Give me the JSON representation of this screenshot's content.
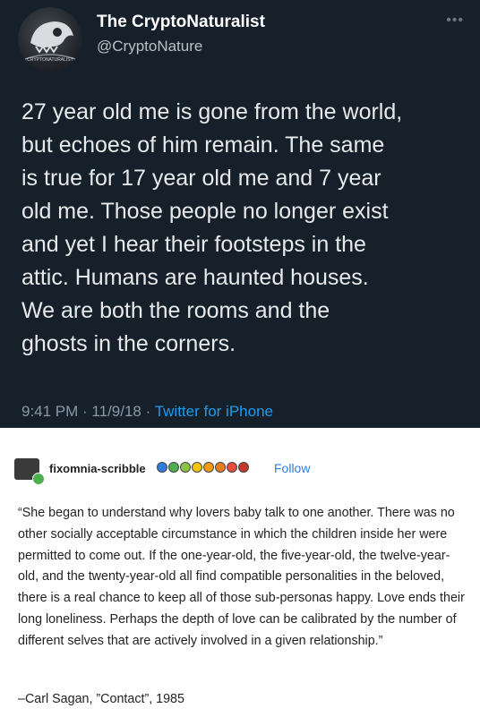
{
  "tweet": {
    "display_name": "The CryptoNaturalist",
    "handle": "@CryptoNature",
    "avatar_text": "CRYPTONATURALIST",
    "more_icon": "ellipsis-icon",
    "text": "27 year old me is gone from the world,\nbut echoes of him remain. The same\nis true for 17 year old me and 7 year\nold me. Those people no longer exist\nand yet I hear their footsteps in the\nattic. Humans are haunted houses.\nWe are both the rooms and the\nghosts in the corners.",
    "time": "9:41 PM",
    "date": "11/9/18",
    "separator": " · ",
    "source": "Twitter for iPhone",
    "colors": {
      "background": "#15202b",
      "link": "#1d9bf0"
    }
  },
  "post": {
    "username": "fixomnia-scribble",
    "follow_label": "Follow",
    "badge_colors": [
      "#2f7ed8",
      "#4cb050",
      "#8bc34a",
      "#f1c40f",
      "#f39c12",
      "#e67e22",
      "#e74c3c",
      "#c0392b"
    ],
    "quote": "“She began to understand why lovers baby talk to one another. There was no other socially acceptable circumstance in which the children inside her were permitted to come out. If the one-year-old, the five-year-old, the twelve-year-old, and the twenty-year-old all find compatible personalities in the beloved, there is a real chance to keep all of those sub-personas happy. Love ends their long loneliness. Perhaps the depth of love can be calibrated by the number of different selves that are actively involved in a given relationship.”",
    "attribution": "–Carl Sagan, ”Contact”, 1985"
  }
}
